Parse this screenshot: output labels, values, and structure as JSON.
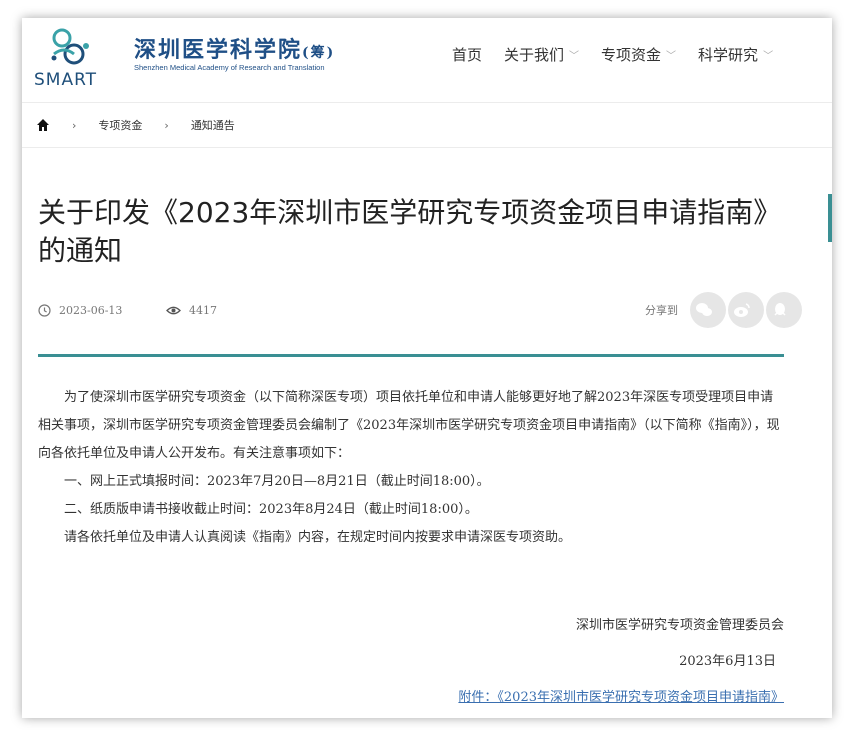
{
  "brand": {
    "logo_text": "SMART",
    "name_cn": "深圳医学科学院",
    "name_suffix": "(筹)",
    "name_en": "Shenzhen Medical Academy of Research and Translation"
  },
  "nav": {
    "items": [
      {
        "label": "首页",
        "has_dropdown": false
      },
      {
        "label": "关于我们",
        "has_dropdown": true
      },
      {
        "label": "专项资金",
        "has_dropdown": true
      },
      {
        "label": "科学研究",
        "has_dropdown": true
      }
    ]
  },
  "breadcrumb": {
    "items": [
      "专项资金",
      "通知通告"
    ],
    "separator": "›"
  },
  "article": {
    "title": "关于印发《2023年深圳市医学研究专项资金项目申请指南》的通知",
    "date": "2023-06-13",
    "views": "4417",
    "share_label": "分享到",
    "share_icons": [
      "wechat-icon",
      "weibo-icon",
      "qq-icon"
    ],
    "paragraphs": [
      "为了使深圳市医学研究专项资金（以下简称深医专项）项目依托单位和申请人能够更好地了解2023年深医专项受理项目申请相关事项，深圳市医学研究专项资金管理委员会编制了《2023年深圳市医学研究专项资金项目申请指南》（以下简称《指南》），现向各依托单位及申请人公开发布。有关注意事项如下：",
      "一、网上正式填报时间：2023年7月20日—8月21日（截止时间18:00）。",
      "二、纸质版申请书接收截止时间：2023年8月24日（截止时间18:00）。",
      "请各依托单位及申请人认真阅读《指南》内容，在规定时间内按要求申请深医专项资助。"
    ],
    "signature": "深圳市医学研究专项资金管理委员会",
    "signature_date": "2023年6月13日",
    "attachment": "附件：《2023年深圳市医学研究专项资金项目申请指南》"
  },
  "colors": {
    "accent": "#3a8f93",
    "brand": "#1f4f86",
    "link": "#3a6fb0"
  }
}
